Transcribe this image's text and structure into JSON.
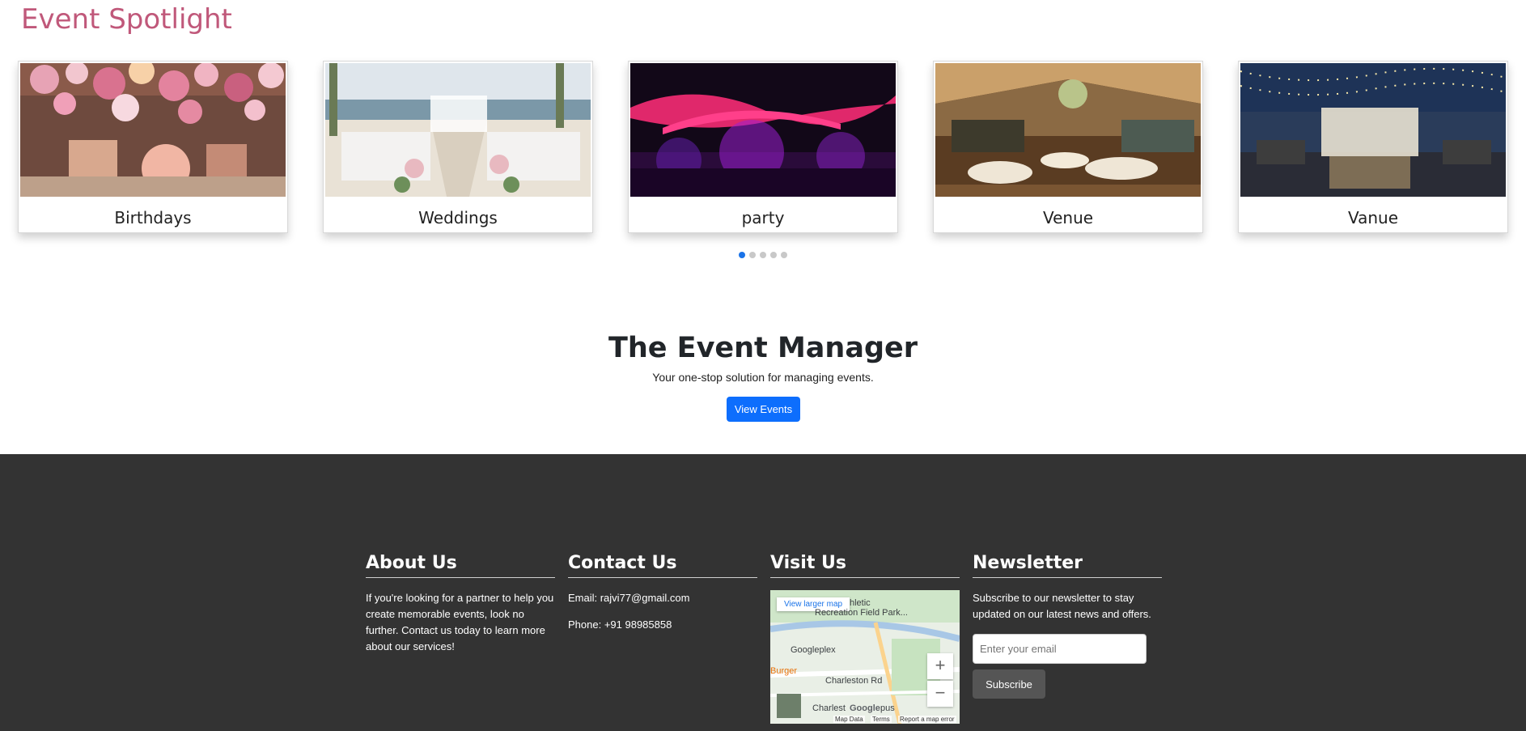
{
  "spotlight": {
    "title": "Event Spotlight",
    "cards": [
      {
        "label": "Birthdays"
      },
      {
        "label": "Weddings"
      },
      {
        "label": "party"
      },
      {
        "label": "Venue"
      },
      {
        "label": "Vanue"
      }
    ],
    "active_slide": 1,
    "slide_count": 5
  },
  "hero": {
    "title": "The Event Manager",
    "subtitle": "Your one-stop solution for managing events.",
    "button_label": "View Events"
  },
  "footer": {
    "about": {
      "heading": "About Us",
      "text": "If you're looking for a partner to help you create memorable events, look no further. Contact us today to learn more about our services!"
    },
    "contact": {
      "heading": "Contact Us",
      "email": "Email: rajvi77@gmail.com",
      "phone": "Phone: +91 98985858"
    },
    "visit": {
      "heading": "Visit Us",
      "map": {
        "view_larger": "View larger map",
        "labels": [
          "hletic",
          "Recreation Field Park...",
          "Googleplex",
          "Burger",
          "Charleston Rd",
          "Charlest",
          "pus",
          "Google"
        ],
        "footer_links": [
          "Map Data",
          "Terms",
          "Report a map error"
        ]
      }
    },
    "newsletter": {
      "heading": "Newsletter",
      "text": "Subscribe to our newsletter to stay updated on our latest news and offers.",
      "email_placeholder": "Enter your email",
      "button_label": "Subscribe"
    }
  },
  "colors": {
    "spotlight_title": "#c0587a",
    "primary_button": "#0d6efd",
    "footer_bg": "#333333"
  }
}
